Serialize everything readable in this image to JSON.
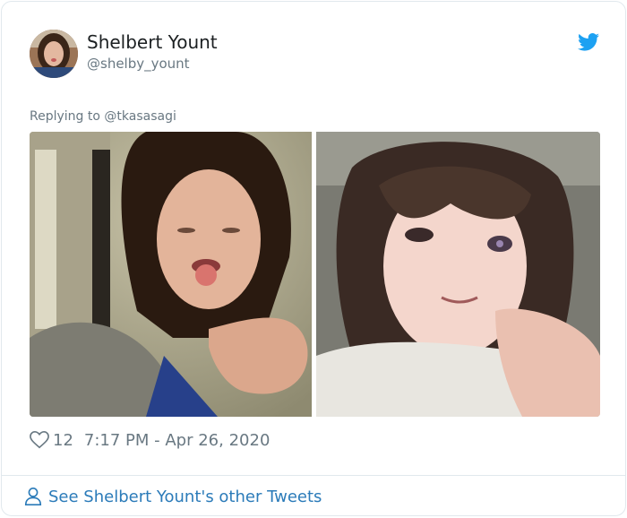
{
  "tweet": {
    "author": {
      "display_name": "Shelbert Yount",
      "handle": "@shelby_yount"
    },
    "reply_prefix": "Replying to",
    "reply_to": "@tkasasagi",
    "likes": "12",
    "timestamp": "7:17 PM - Apr 26, 2020",
    "icons": {
      "brand": "twitter-bird-icon",
      "like": "heart-icon",
      "profile": "person-icon"
    }
  },
  "footer": {
    "cta": "See Shelbert Yount's other Tweets"
  },
  "colors": {
    "brand_blue": "#1da1f2",
    "link_blue": "#2b7bb9",
    "secondary_text": "#697882",
    "border": "#e1e8ed"
  }
}
